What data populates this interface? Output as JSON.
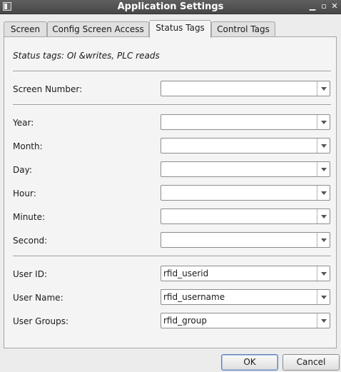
{
  "window": {
    "title": "Application Settings"
  },
  "tabs": [
    {
      "label": "Screen"
    },
    {
      "label": "Config Screen Access"
    },
    {
      "label": "Status Tags"
    },
    {
      "label": "Control Tags"
    }
  ],
  "active_tab": "Status Tags",
  "description": "Status tags: OI &writes, PLC reads",
  "fields": {
    "screen_number": {
      "label": "Screen Number:",
      "value": ""
    },
    "year": {
      "label": "Year:",
      "value": ""
    },
    "month": {
      "label": "Month:",
      "value": ""
    },
    "day": {
      "label": "Day:",
      "value": ""
    },
    "hour": {
      "label": "Hour:",
      "value": ""
    },
    "minute": {
      "label": "Minute:",
      "value": ""
    },
    "second": {
      "label": "Second:",
      "value": ""
    },
    "user_id": {
      "label": "User ID:",
      "value": "rfid_userid"
    },
    "user_name": {
      "label": "User Name:",
      "value": "rfid_username"
    },
    "user_groups": {
      "label": "User Groups:",
      "value": "rfid_group"
    }
  },
  "buttons": {
    "ok": "OK",
    "cancel": "Cancel"
  },
  "icons": {
    "app": "app-window-icon",
    "minimize": "minimize-icon",
    "maximize": "maximize-icon",
    "close": "close-icon"
  }
}
